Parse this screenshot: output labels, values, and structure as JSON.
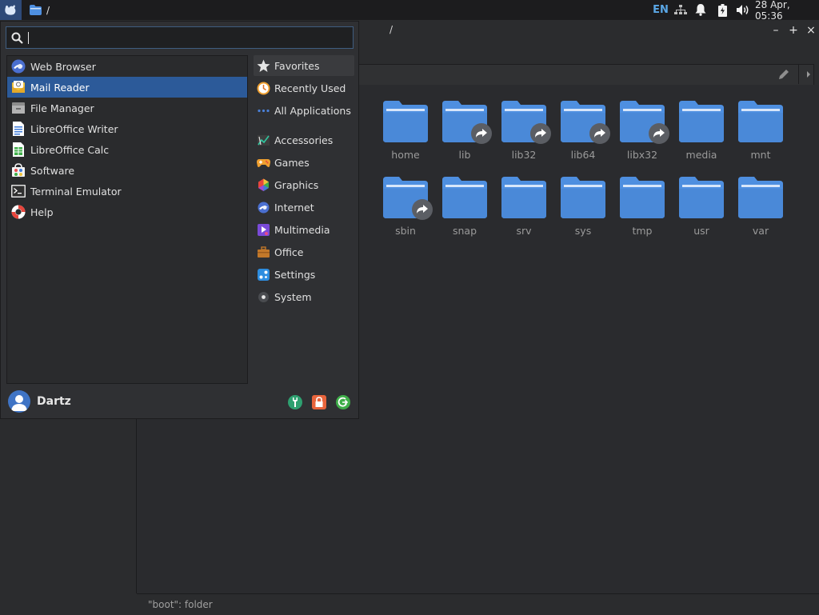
{
  "panel": {
    "task_label": "/",
    "lang": "EN",
    "clock": "28 Apr, 05:36"
  },
  "file_manager": {
    "title": "/",
    "status": "\"boot\": folder",
    "folders_row1": [
      "home",
      "lib",
      "lib32",
      "lib64",
      "libx32",
      "media",
      "mnt"
    ],
    "folders_row2": [
      "sbin",
      "snap",
      "srv",
      "sys",
      "tmp",
      "usr",
      "var"
    ]
  },
  "menu": {
    "search": {
      "value": "",
      "placeholder": ""
    },
    "apps": [
      {
        "label": "Web Browser",
        "icon": "web-browser-icon"
      },
      {
        "label": "Mail Reader",
        "icon": "mail-reader-icon"
      },
      {
        "label": "File Manager",
        "icon": "file-manager-icon"
      },
      {
        "label": "LibreOffice Writer",
        "icon": "writer-icon"
      },
      {
        "label": "LibreOffice Calc",
        "icon": "calc-icon"
      },
      {
        "label": "Software",
        "icon": "software-icon"
      },
      {
        "label": "Terminal Emulator",
        "icon": "terminal-icon"
      },
      {
        "label": "Help",
        "icon": "help-icon"
      }
    ],
    "categories": [
      {
        "label": "Favorites",
        "icon": "star-icon"
      },
      {
        "label": "Recently Used",
        "icon": "clock-icon"
      },
      {
        "label": "All Applications",
        "icon": "dots-icon"
      },
      {
        "label": "Accessories",
        "icon": "accessories-icon"
      },
      {
        "label": "Games",
        "icon": "gamepad-icon"
      },
      {
        "label": "Graphics",
        "icon": "graphics-icon"
      },
      {
        "label": "Internet",
        "icon": "internet-icon"
      },
      {
        "label": "Multimedia",
        "icon": "multimedia-icon"
      },
      {
        "label": "Office",
        "icon": "briefcase-icon"
      },
      {
        "label": "Settings",
        "icon": "settings-icon"
      },
      {
        "label": "System",
        "icon": "system-icon"
      }
    ],
    "username": "Dartz"
  },
  "colors": {
    "accent": "#2c5a99",
    "folder": "#4e8fe0",
    "panel": "#1c1c1e",
    "lang": "#5aa7e6"
  }
}
